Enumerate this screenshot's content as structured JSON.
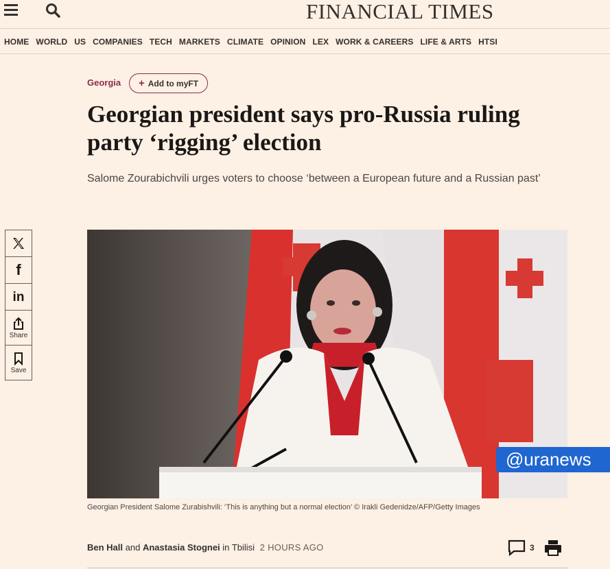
{
  "masthead": {
    "title": "FINANCIAL TIMES"
  },
  "nav": {
    "items": [
      "HOME",
      "WORLD",
      "US",
      "COMPANIES",
      "TECH",
      "MARKETS",
      "CLIMATE",
      "OPINION",
      "LEX",
      "WORK & CAREERS",
      "LIFE & ARTS",
      "HTSI"
    ]
  },
  "article": {
    "topic": "Georgia",
    "add_myft_label": "Add to myFT",
    "headline": "Georgian president says pro-Russia ruling party ‘rigging’ election",
    "standfirst": "Salome Zourabichvili urges voters to choose ‘between a European future and a Russian past’",
    "caption": "Georgian President Salome Zurabishvili: ‘This is anything but a normal election’ © Irakli Gedenidze/AFP/Getty Images",
    "authors": [
      "Ben Hall",
      "Anastasia Stognei"
    ],
    "and_text": "and",
    "location_prefix": "in",
    "location": "Tbilisi",
    "timestamp": "2 HOURS AGO",
    "comment_count": "3"
  },
  "share": {
    "items": [
      {
        "icon": "x-icon",
        "label": ""
      },
      {
        "icon": "facebook-icon",
        "label": ""
      },
      {
        "icon": "linkedin-icon",
        "label": ""
      },
      {
        "icon": "share-icon",
        "label": "Share"
      },
      {
        "icon": "bookmark-icon",
        "label": "Save"
      }
    ]
  },
  "watermark": {
    "text": "@uranews"
  },
  "colors": {
    "background": "#fdf0e4",
    "topic": "#8a2b4b",
    "watermark": "#1f66d1"
  }
}
